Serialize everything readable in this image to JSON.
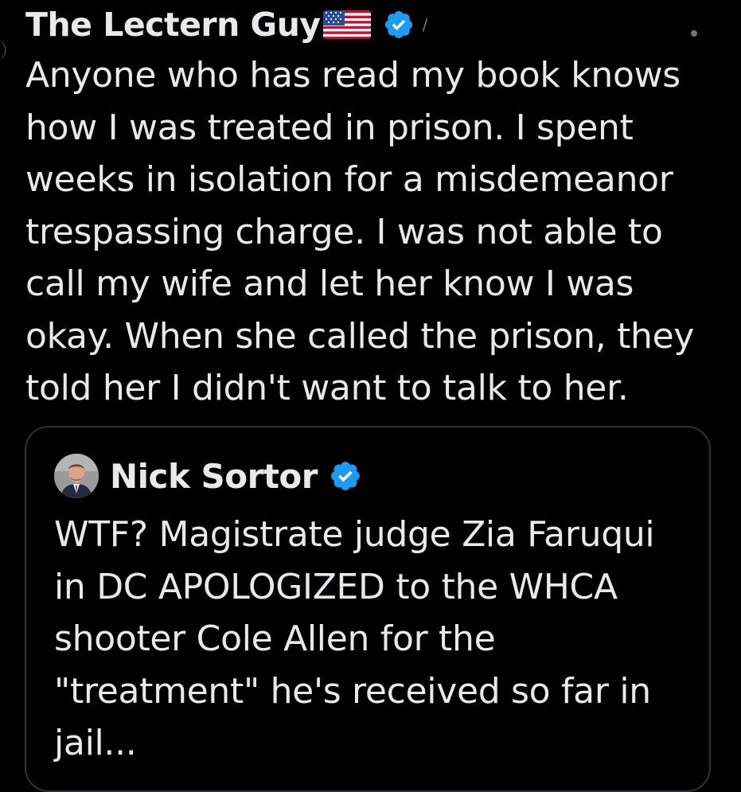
{
  "tweet": {
    "author_name": "The Lectern Guy",
    "flag_icon": "us-flag-icon",
    "verified_icon": "verified-badge-icon",
    "handle_fragment": "/",
    "more_icon": "more-dot-icon",
    "text_lines": [
      "Anyone who has read my book knows",
      "how I was treated in prison. I spent",
      "weeks in isolation for a misdemeanor",
      "trespassing charge. I was not able to",
      "call my wife and let her know I was",
      "okay. When she called the prison, they",
      "told her I didn't want to talk to her."
    ]
  },
  "quote": {
    "author_name": "Nick Sortor",
    "avatar_icon": "avatar",
    "verified_icon": "verified-badge-icon",
    "text_lines": [
      "WTF? Magistrate judge Zia Faruqui",
      "in DC APOLOGIZED to the WHCA",
      "shooter Cole Allen for the",
      "\"treatment\" he's received so far in",
      "jail..."
    ]
  },
  "colors": {
    "background": "#000000",
    "text": "#e7e9ea",
    "verified": "#1d9bf0",
    "border": "#2f3336",
    "muted": "#71767b"
  }
}
